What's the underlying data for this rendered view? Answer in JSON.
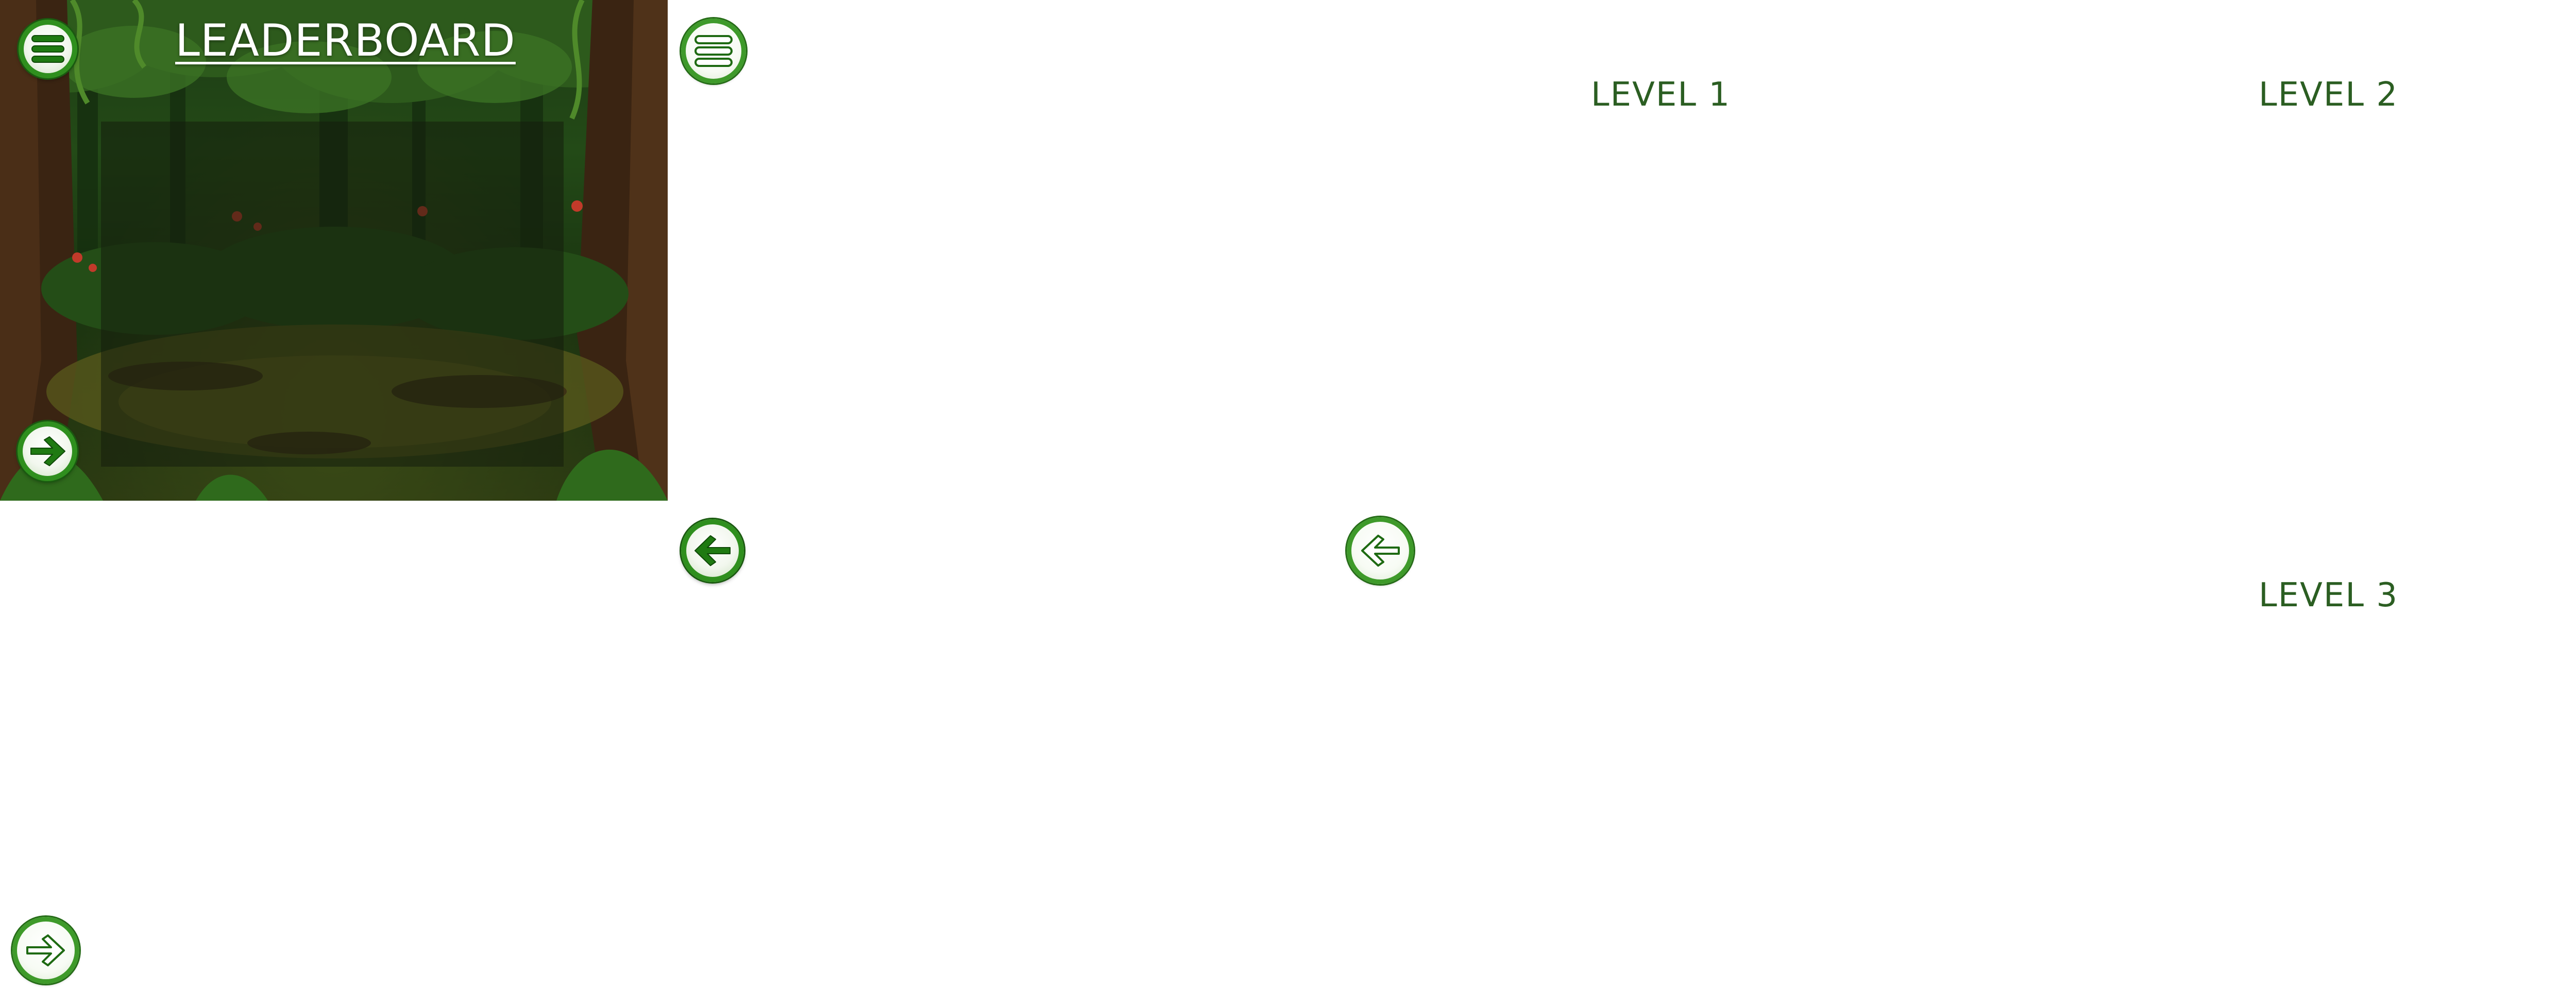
{
  "leaderboard": {
    "title": "LEADERBOARD",
    "buttons": {
      "menu_icon": "hamburger-menu-icon",
      "next_icon": "arrow-right-icon"
    }
  },
  "levels_screen": {
    "menu_icon": "hamburger-menu-icon",
    "back_icon": "arrow-left-icon",
    "levels": [
      {
        "label": "LEVEL 1"
      },
      {
        "label": "LEVEL 2"
      },
      {
        "label": "LEVEL 3"
      }
    ]
  },
  "theme": {
    "button_green": "#2f8f1e",
    "label_green": "#2b5e22",
    "title_color": "#ffffff",
    "forest_dark": "#1d3a14"
  }
}
